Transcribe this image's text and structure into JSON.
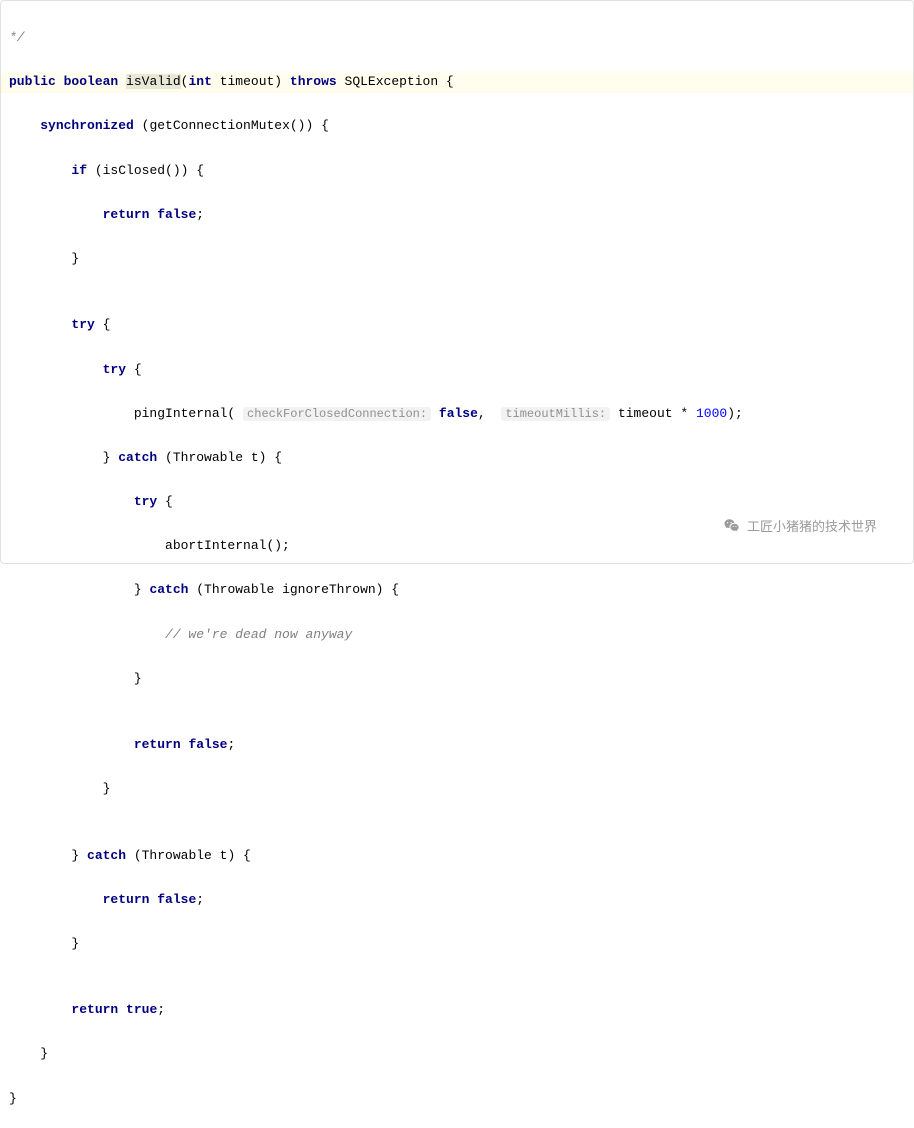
{
  "doc_end": "*/",
  "sig": {
    "public": "public",
    "boolean": "boolean",
    "isValid": "isValid",
    "lparen": "(",
    "int": "int",
    "timeout": "timeout",
    "rparen_sp": ") ",
    "throws": "throws",
    "SQLException": " SQLException {"
  },
  "l2": {
    "a": "    ",
    "synchronized": "synchronized",
    "b": " (getConnectionMutex()) {"
  },
  "l3": {
    "a": "        ",
    "if": "if",
    "b": " (isClosed()) {"
  },
  "l4": {
    "a": "            ",
    "return": "return",
    "sp": " ",
    "false": "false",
    "c": ";"
  },
  "l5": "        }",
  "l6": "",
  "l7": {
    "a": "        ",
    "try": "try",
    "b": " {"
  },
  "l8": {
    "a": "            ",
    "try": "try",
    "b": " {"
  },
  "l9": {
    "a": "                pingInternal( ",
    "hint1": "checkForClosedConnection:",
    "sp1": " ",
    "false": "false",
    "comma": ",  ",
    "hint2": "timeoutMillis:",
    "sp2": " timeout * ",
    "num": "1000",
    "end": ");"
  },
  "l10": {
    "a": "            } ",
    "catch": "catch",
    "b": " (Throwable t) {"
  },
  "l11": {
    "a": "                ",
    "try": "try",
    "b": " {"
  },
  "l12": "                    abortInternal();",
  "l13": {
    "a": "                } ",
    "catch": "catch",
    "b": " (Throwable ignoreThrown) {"
  },
  "l14": {
    "a": "                    ",
    "c": "// we're dead now anyway"
  },
  "l15": "                }",
  "l16": "",
  "l17": {
    "a": "                ",
    "return": "return",
    "sp": " ",
    "false": "false",
    "c": ";"
  },
  "l18": "            }",
  "l19": "",
  "l20": {
    "a": "        } ",
    "catch": "catch",
    "b": " (Throwable t) {"
  },
  "l21": {
    "a": "            ",
    "return": "return",
    "sp": " ",
    "false": "false",
    "c": ";"
  },
  "l22": "        }",
  "l23": "",
  "l24": {
    "a": "        ",
    "return": "return",
    "sp": " ",
    "true": "true",
    "c": ";"
  },
  "l25": "    }",
  "l26": "}",
  "watermark": "工匠小猪猪的技术世界"
}
